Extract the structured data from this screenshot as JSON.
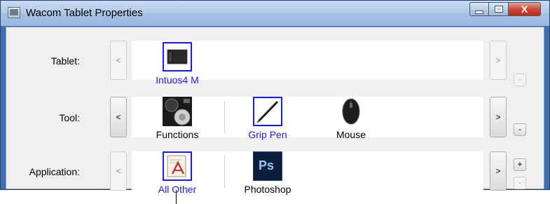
{
  "window": {
    "title": "Wacom Tablet Properties",
    "icon": "wacom-app-icon",
    "controls": {
      "minimize": "minimize-icon",
      "maximize": "maximize-icon",
      "close": "X"
    }
  },
  "rows": {
    "tablet": {
      "label": "Tablet:",
      "prev": "<",
      "next": ">",
      "remove": "-",
      "items": [
        {
          "label": "Intuos4 M",
          "icon": "tablet-icon",
          "selected": true
        }
      ]
    },
    "tool": {
      "label": "Tool:",
      "prev": "<",
      "next": ">",
      "remove": "-",
      "items": [
        {
          "label": "Functions",
          "icon": "functions-icon",
          "selected": false
        },
        {
          "label": "Grip Pen",
          "icon": "pen-icon",
          "selected": true
        },
        {
          "label": "Mouse",
          "icon": "mouse-icon",
          "selected": false
        }
      ]
    },
    "application": {
      "label": "Application:",
      "prev": "<",
      "next": ">",
      "add": "+",
      "remove": "-",
      "items": [
        {
          "label": "All Other",
          "icon": "all-other-apps-icon",
          "selected": true
        },
        {
          "label": "Photoshop",
          "icon": "photoshop-icon",
          "icon_text": "Ps",
          "selected": false
        }
      ]
    }
  },
  "colors": {
    "selected_text": "#1a1aff",
    "selection_border": "#1c1ce6",
    "titlebar": "#b3cbe9",
    "window_frame": "#3f6fb0"
  }
}
